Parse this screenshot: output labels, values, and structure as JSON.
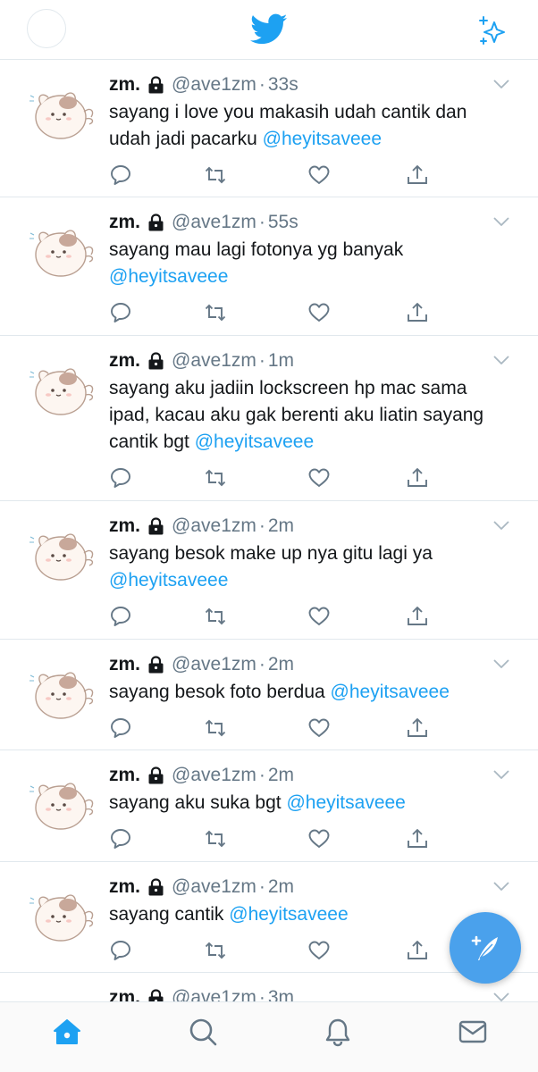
{
  "header": {
    "logo_icon": "twitter-bird-icon",
    "sparkle_icon": "sparkle-icon",
    "accent_color": "#1da1f2"
  },
  "tweets": [
    {
      "name": "zm.",
      "handle": "@ave1zm",
      "dot": "·",
      "time": "33s",
      "text": "sayang i love you makasih udah cantik dan udah jadi pacarku ",
      "mention": "@heyitsaveee"
    },
    {
      "name": "zm.",
      "handle": "@ave1zm",
      "dot": "·",
      "time": "55s",
      "text": "sayang mau lagi fotonya yg banyak ",
      "mention": "@heyitsaveee"
    },
    {
      "name": "zm.",
      "handle": "@ave1zm",
      "dot": "·",
      "time": "1m",
      "text": "sayang aku jadiin lockscreen hp mac sama ipad, kacau aku gak berenti aku liatin sayang cantik bgt ",
      "mention": "@heyitsaveee"
    },
    {
      "name": "zm.",
      "handle": "@ave1zm",
      "dot": "·",
      "time": "2m",
      "text": "sayang besok make up nya gitu lagi ya ",
      "mention": "@heyitsaveee"
    },
    {
      "name": "zm.",
      "handle": "@ave1zm",
      "dot": "·",
      "time": "2m",
      "text": "sayang besok foto berdua ",
      "mention": "@heyitsaveee"
    },
    {
      "name": "zm.",
      "handle": "@ave1zm",
      "dot": "·",
      "time": "2m",
      "text": "sayang aku suka bgt ",
      "mention": "@heyitsaveee"
    },
    {
      "name": "zm.",
      "handle": "@ave1zm",
      "dot": "·",
      "time": "2m",
      "text": "sayang cantik ",
      "mention": "@heyitsaveee"
    },
    {
      "name": "zm.",
      "handle": "@ave1zm",
      "dot": "·",
      "time": "3m",
      "text": "",
      "mention": ""
    }
  ],
  "fab": {
    "icon": "compose-tweet-icon",
    "color": "#4aa1ec"
  },
  "bottom_nav": {
    "items": [
      "home-icon",
      "search-icon",
      "notifications-icon",
      "messages-icon"
    ],
    "active": "home-icon"
  }
}
